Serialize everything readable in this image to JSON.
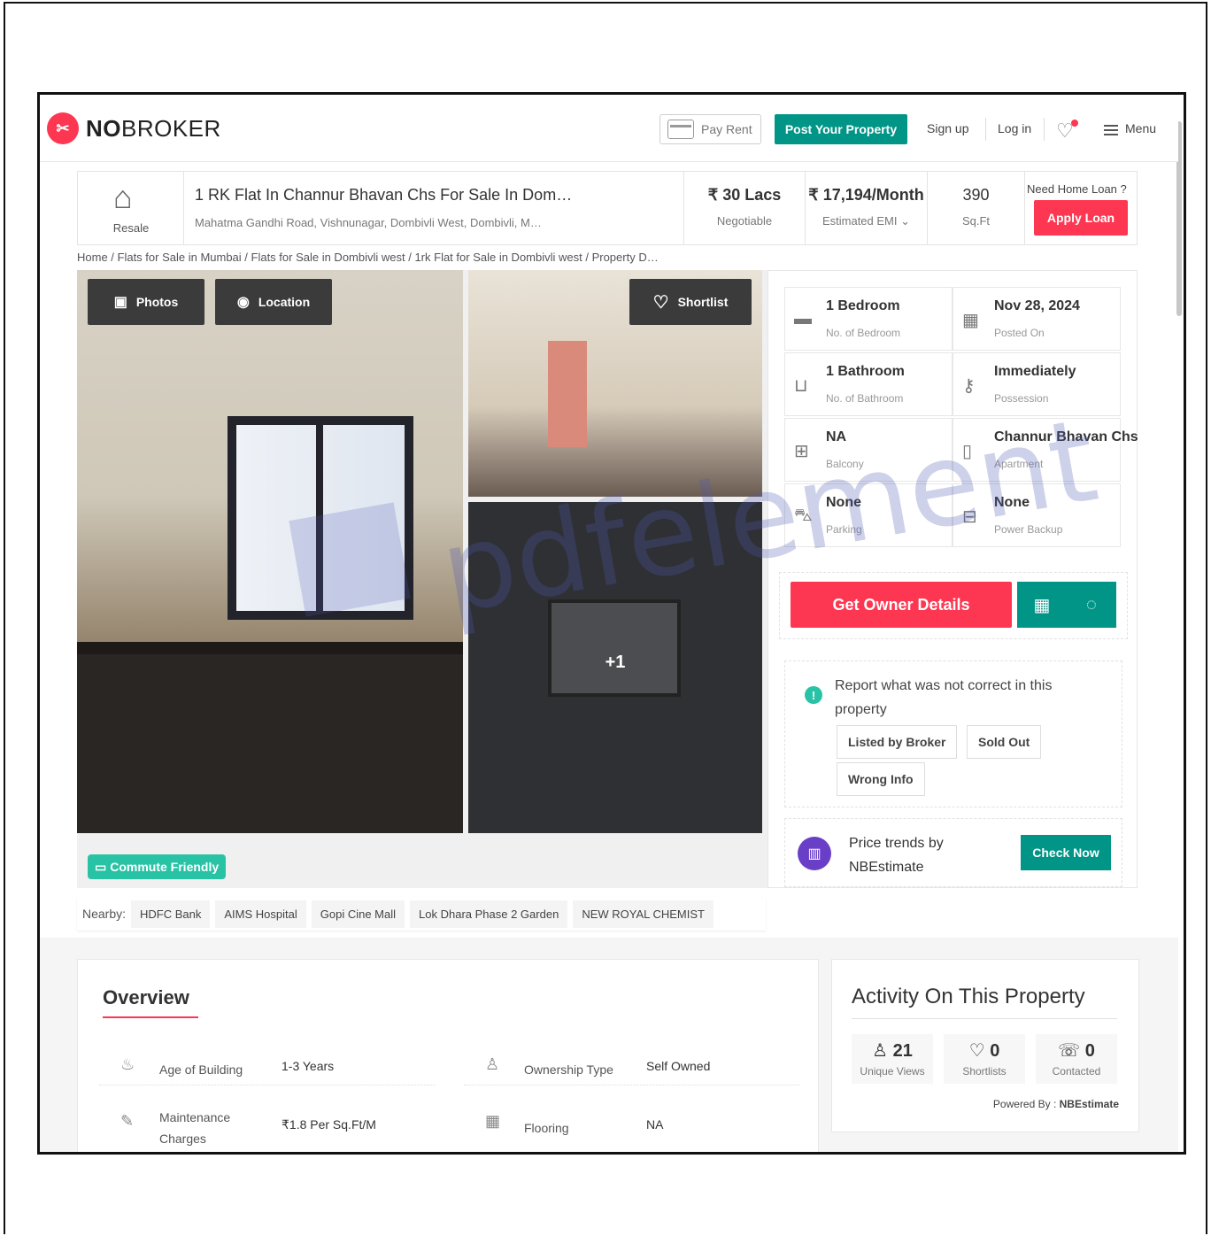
{
  "header": {
    "logo_no": "NO",
    "logo_broker": "BROKER",
    "pay_rent": "Pay Rent",
    "post_property": "Post Your Property",
    "sign_up": "Sign up",
    "log_in": "Log in",
    "menu": "Menu"
  },
  "summary": {
    "resale": "Resale",
    "title": "1 RK Flat In Channur Bhavan Chs For Sale In Dom…",
    "address": "Mahatma Gandhi Road, Vishnunagar, Dombivli West, Dombivli, M…",
    "price": "₹ 30 Lacs",
    "price_sub": "Negotiable",
    "emi": "₹ 17,194/Month",
    "emi_sub": "Estimated EMI",
    "area": "390",
    "area_sub": "Sq.Ft",
    "loan_q": "Need Home Loan ?",
    "apply_loan": "Apply Loan"
  },
  "breadcrumb": "Home / Flats for Sale in Mumbai / Flats for Sale in Dombivli west / 1rk Flat for Sale in Dombivli west / Property D…",
  "gallery": {
    "photos": "Photos",
    "location": "Location",
    "shortlist": "Shortlist",
    "more": "+1",
    "commute": "Commute Friendly"
  },
  "details": {
    "cells": [
      {
        "value": "1 Bedroom",
        "sub": "No. of Bedroom",
        "icon": "bed-icon"
      },
      {
        "value": "Nov 28, 2024",
        "sub": "Posted On",
        "icon": "calendar-icon"
      },
      {
        "value": "1 Bathroom",
        "sub": "No. of Bathroom",
        "icon": "bathtub-icon"
      },
      {
        "value": "Immediately",
        "sub": "Possession",
        "icon": "key-icon"
      },
      {
        "value": "NA",
        "sub": "Balcony",
        "icon": "balcony-icon"
      },
      {
        "value": "Channur Bhavan Chs",
        "sub": "Apartment",
        "icon": "building-icon"
      },
      {
        "value": "None",
        "sub": "Parking",
        "icon": "car-icon"
      },
      {
        "value": "None",
        "sub": "Power Backup",
        "icon": "battery-icon"
      }
    ],
    "get_owner": "Get Owner Details",
    "report_text": "Report what was not correct in this property",
    "chips": [
      "Listed by Broker",
      "Sold Out",
      "Wrong Info"
    ],
    "trend_text": "Price trends by NBEstimate",
    "check_now": "Check Now"
  },
  "nearby": {
    "label": "Nearby:",
    "items": [
      "HDFC Bank",
      "AIMS Hospital",
      "Gopi Cine Mall",
      "Lok Dhara Phase 2 Garden",
      "NEW ROYAL CHEMIST"
    ]
  },
  "overview": {
    "title": "Overview",
    "rows": [
      {
        "label": "Age of Building",
        "value": "1-3 Years"
      },
      {
        "label": "Ownership Type",
        "value": "Self Owned"
      },
      {
        "label": "Maintenance Charges",
        "value": "₹1.8 Per Sq.Ft/M"
      },
      {
        "label": "Flooring",
        "value": "NA"
      }
    ]
  },
  "activity": {
    "title": "Activity On This Property",
    "views": "21",
    "views_label": "Unique Views",
    "shortlists": "0",
    "shortlists_label": "Shortlists",
    "contacted": "0",
    "contacted_label": "Contacted",
    "powered_by": "Powered By :",
    "powered_name": "NBEstimate"
  },
  "watermark": "pdfelement",
  "colors": {
    "brand_red": "#fd3752",
    "teal": "#009587",
    "commute": "#28c3a5"
  }
}
